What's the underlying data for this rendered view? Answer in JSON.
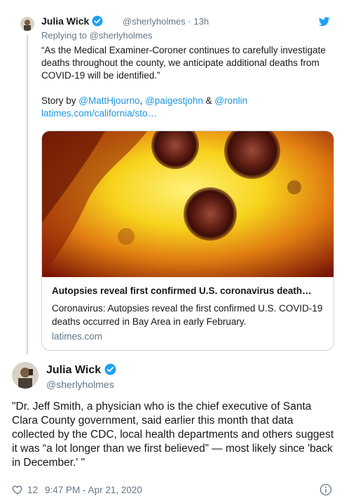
{
  "tweet1": {
    "name": "Julia Wick",
    "handle": "@sherlyholmes",
    "time": "13h",
    "replying_prefix": "Replying to",
    "replying_handle": "@sherlyholmes",
    "text_para1": "“As the Medical Examiner-Coroner continues to carefully investigate deaths throughout the county, we anticipate additional deaths from COVID-19 will be identified.”",
    "story_by": "Story by",
    "author1": "@MattHjourno",
    "author2": "@paigestjohn",
    "amp": "&",
    "author3": "@ronlin",
    "link_text": "latimes.com/california/sto…",
    "card": {
      "title": "Autopsies reveal first confirmed U.S. coronavirus death…",
      "description": "Coronavirus: Autopsies reveal the first confirmed U.S. COVID-19 deaths occurred in Bay Area in early February.",
      "domain": "latimes.com"
    }
  },
  "tweet2": {
    "name": "Julia Wick",
    "handle": "@sherlyholmes",
    "text": "\"Dr. Jeff Smith, a physician who is the chief executive of Santa Clara County government, said earlier this month that data collected by the CDC, local health departments and others suggest it was “a lot longer than we first believed” — most likely since 'back in December.' \"",
    "likes": "12",
    "timestamp": "9:47 PM - Apr 21, 2020"
  },
  "icons": {
    "verified": "verified-badge-icon",
    "twitter": "twitter-bird-icon",
    "like": "heart-icon",
    "info": "info-icon"
  },
  "colors": {
    "link": "#1b95e0",
    "secondary_text": "#657786",
    "verified": "#1da1f2"
  }
}
